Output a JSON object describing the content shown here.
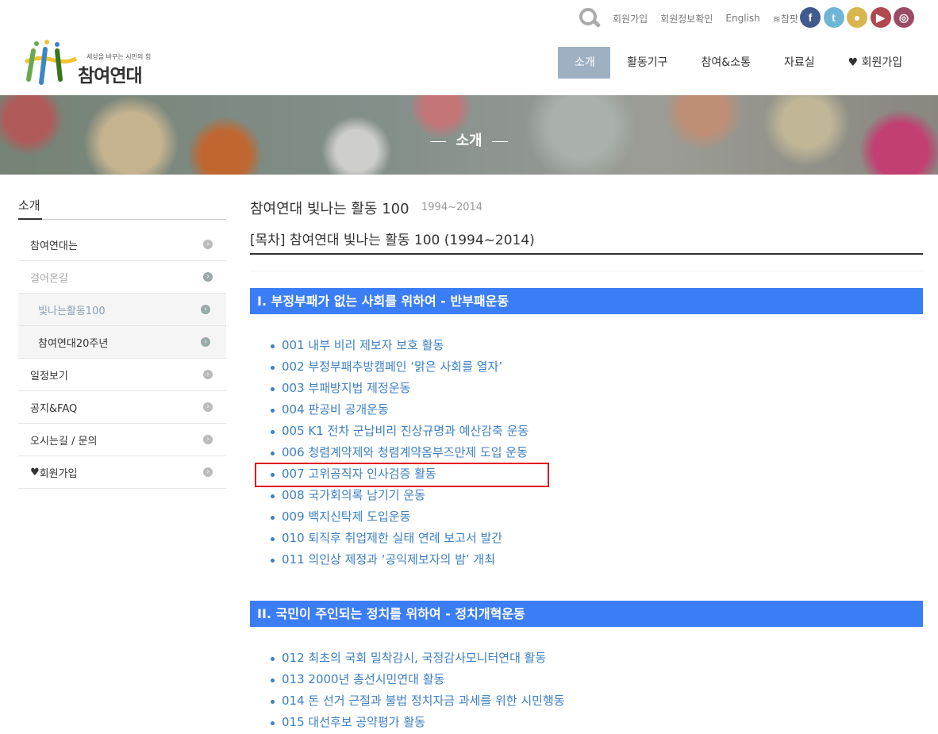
{
  "util": {
    "links": [
      "회원가입",
      "회원정보확인",
      "English"
    ],
    "wifi_label": "참팟"
  },
  "social": [
    {
      "icon": "facebook-icon",
      "glyph": "f",
      "color": "#3f5a8f"
    },
    {
      "icon": "twitter-icon",
      "glyph": "t",
      "color": "#6fb5d6"
    },
    {
      "icon": "kakaotalk-icon",
      "glyph": "●",
      "color": "#d8b54e"
    },
    {
      "icon": "youtube-icon",
      "glyph": "▶",
      "color": "#b0484d"
    },
    {
      "icon": "instagram-icon",
      "glyph": "◎",
      "color": "#9c4a66"
    }
  ],
  "logo": {
    "tagline": "세상을 바꾸는 시민의 힘",
    "name": "참여연대"
  },
  "nav": [
    "소개",
    "활동기구",
    "참여&소통",
    "자료실",
    "회원가입"
  ],
  "banner": {
    "title": "소개"
  },
  "sidebar": {
    "title": "소개",
    "items": [
      {
        "label": "참여연대는",
        "type": "top"
      },
      {
        "label": "걸어온길",
        "type": "muted"
      },
      {
        "label": "빛나는활동100",
        "type": "sub selected"
      },
      {
        "label": "참여연대20주년",
        "type": "sub"
      },
      {
        "label": "일정보기",
        "type": "top"
      },
      {
        "label": "공지&FAQ",
        "type": "top"
      },
      {
        "label": "오시는길 / 문의",
        "type": "top"
      },
      {
        "label": "회원가입",
        "type": "top heart"
      }
    ]
  },
  "main": {
    "title": "참여연대 빛나는 활동 100",
    "years": "1994~2014",
    "doc_title": "[목차] 참여연대 빛나는 활동 100 (1994~2014)",
    "sections": [
      {
        "heading": "I. 부정부패가 없는 사회를 위하여 - 반부패운동",
        "items": [
          "001 내부 비리 제보자 보호 활동",
          "002 부정부패추방캠페인 ‘맑은 사회를 열자’",
          "003 부패방지법 제정운동",
          "004 판공비 공개운동",
          "005 K1 전차 군납비리 진상규명과 예산감축 운동",
          "006 청렴계약제와 청렴계약옴부즈만제 도입 운동",
          "007 고위공직자 인사검증 활동",
          "008 국가회의록 남기기 운동",
          "009 백지신탁제 도입운동",
          "010 퇴직후 취업제한 실태 연례 보고서 발간",
          "011 의인상 제정과 ‘공익제보자의 밤’ 개최"
        ]
      },
      {
        "heading": "II. 국민이 주인되는 정치를 위하여 - 정치개혁운동",
        "items": [
          "012 최초의 국회 밀착감시, 국정감사모니터연대 활동",
          "013 2000년 총선시민연대 활동",
          "014 돈 선거 근절과 불법 정치자금 과세를 위한 시민행동",
          "015 대선후보 공약평가 활동"
        ]
      }
    ]
  }
}
